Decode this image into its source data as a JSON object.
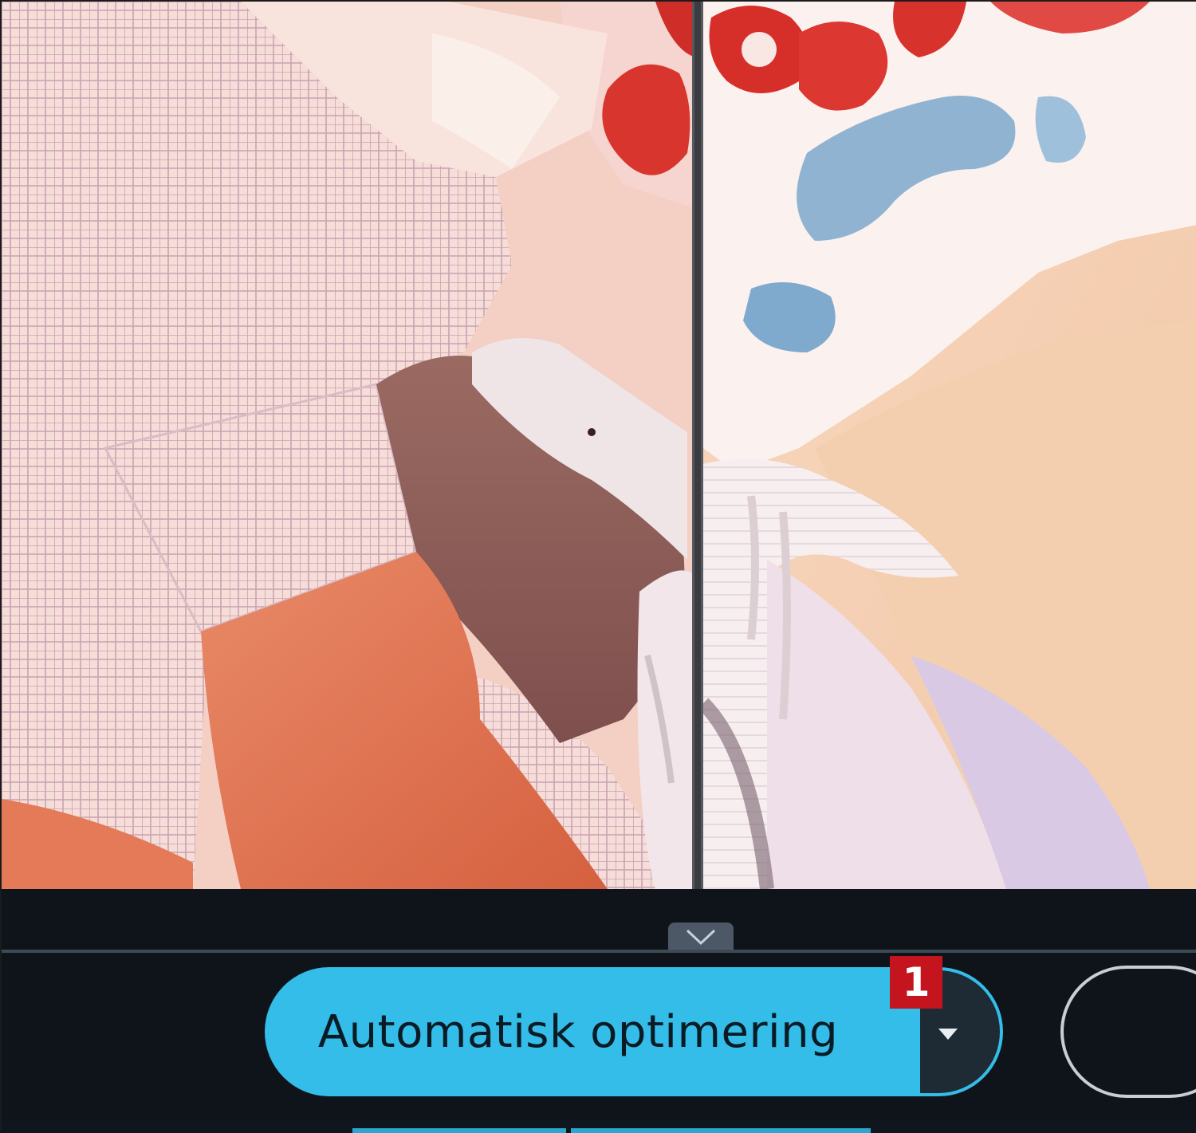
{
  "preview": {
    "left_label": "",
    "right_label": ""
  },
  "toolbar": {
    "collapse_icon": "chevron-down-icon",
    "auto_optimize_label": "Automatisk optimering",
    "dropdown_icon": "caret-down-icon",
    "step_badge": "1"
  },
  "colors": {
    "accent": "#33bde8",
    "badge": "#c4141e",
    "toolbar_bg": "#0e141a"
  }
}
